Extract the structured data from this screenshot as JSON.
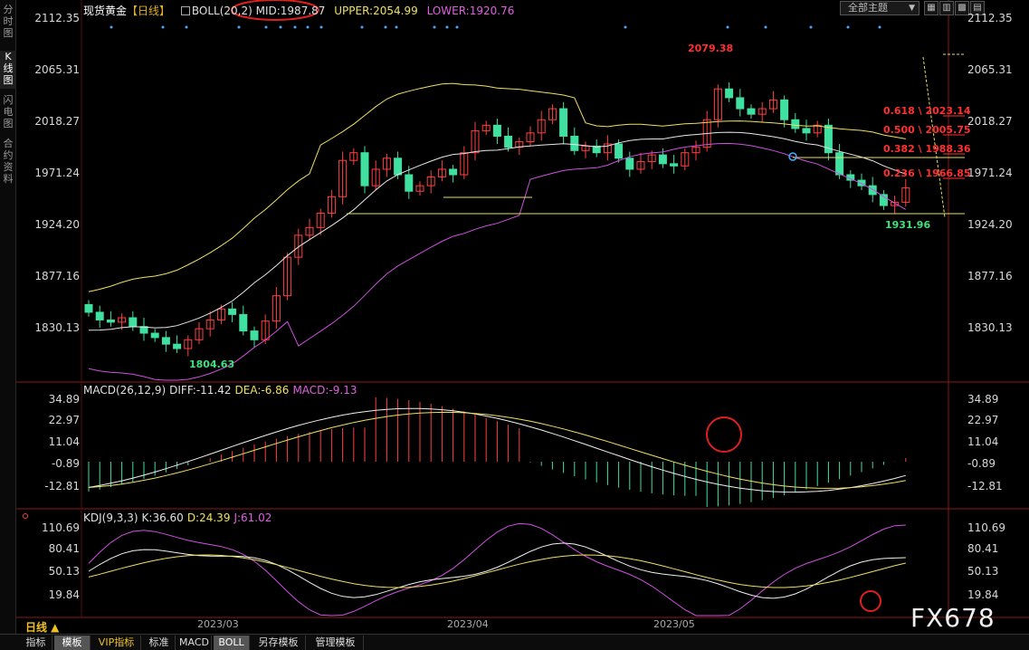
{
  "leftbar": {
    "tabs": [
      {
        "label": "分\n时\n图",
        "active": false
      },
      {
        "label": "K\n线\n图",
        "active": true
      },
      {
        "label": "闪\n电\n图",
        "active": false
      },
      {
        "label": "合\n约\n资\n料",
        "active": false
      }
    ]
  },
  "header": {
    "title": "现货黄金",
    "period": "【日线】",
    "boll_label": "BOLL(20,2)",
    "mid": "MID:1987.87",
    "upper": "UPPER:2054.99",
    "lower": "LOWER:1920.76",
    "theme_select": "全部主题"
  },
  "main_axis": [
    "2112.35",
    "2065.31",
    "2018.27",
    "1971.24",
    "1924.20",
    "1877.16",
    "1830.13"
  ],
  "annotations": {
    "high": "2079.38",
    "low_left": "1804.63",
    "low_right": "1931.96",
    "fib": [
      {
        "label": "0.618 \\ 2023.14"
      },
      {
        "label": "0.500 \\ 2005.75"
      },
      {
        "label": "0.382 \\ 1988.36"
      },
      {
        "label": "0.236 \\ 1966.85"
      }
    ]
  },
  "macd": {
    "label": "MACD(26,12,9)",
    "diff": "DIFF:-11.42",
    "dea": "DEA:-6.86",
    "macd": "MACD:-9.13",
    "axis": [
      "34.89",
      "22.97",
      "11.04",
      "-0.89",
      "-12.81"
    ]
  },
  "kdj": {
    "label": "KDJ(9,3,3)",
    "k": "K:36.60",
    "d": "D:24.39",
    "j": "J:61.02",
    "axis": [
      "110.69",
      "80.41",
      "50.13",
      "19.84"
    ]
  },
  "months": [
    "2023/03",
    "2023/04",
    "2023/05"
  ],
  "period_button": "日线 ▲",
  "bottom_tabs": [
    {
      "label": "指标",
      "active": false,
      "vip": false
    },
    {
      "label": "模板",
      "active": true,
      "vip": false
    },
    {
      "label": "VIP指标",
      "active": false,
      "vip": true
    },
    {
      "label": "标准",
      "active": false,
      "vip": false
    },
    {
      "label": "MACD",
      "active": false,
      "vip": false
    },
    {
      "label": "BOLL",
      "active": true,
      "vip": false
    },
    {
      "label": "另存模板",
      "active": false,
      "vip": false
    },
    {
      "label": "管理模板",
      "active": false,
      "vip": false
    }
  ],
  "watermark": "FX678",
  "colors": {
    "up": "#ff4040",
    "down": "#40e0a0",
    "boll_mid": "#e8e8e8",
    "boll_upper": "#f0e060",
    "boll_lower": "#d050e0",
    "highlight": "#e02020"
  }
}
